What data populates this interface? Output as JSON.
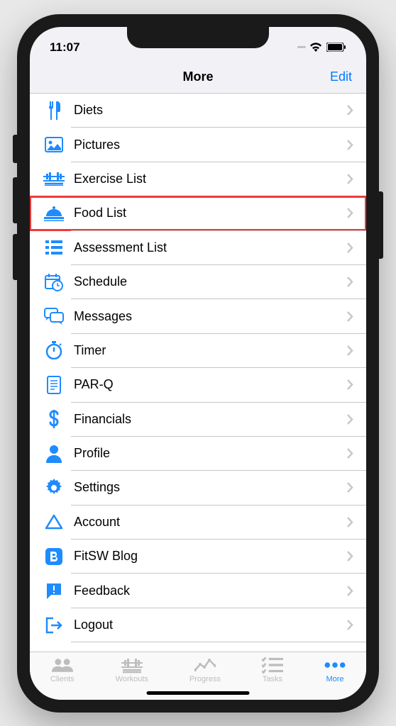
{
  "status": {
    "time": "11:07"
  },
  "nav": {
    "title": "More",
    "edit": "Edit"
  },
  "menu": {
    "items": [
      {
        "label": "Diets",
        "icon": "utensils-icon"
      },
      {
        "label": "Pictures",
        "icon": "image-icon"
      },
      {
        "label": "Exercise List",
        "icon": "barbell-icon"
      },
      {
        "label": "Food List",
        "icon": "cloche-icon",
        "highlighted": true
      },
      {
        "label": "Assessment List",
        "icon": "list-icon"
      },
      {
        "label": "Schedule",
        "icon": "calendar-clock-icon"
      },
      {
        "label": "Messages",
        "icon": "chat-icon"
      },
      {
        "label": "Timer",
        "icon": "stopwatch-icon"
      },
      {
        "label": "PAR-Q",
        "icon": "document-icon"
      },
      {
        "label": "Financials",
        "icon": "dollar-icon"
      },
      {
        "label": "Profile",
        "icon": "profile-icon"
      },
      {
        "label": "Settings",
        "icon": "gear-icon"
      },
      {
        "label": "Account",
        "icon": "triangle-icon"
      },
      {
        "label": "FitSW Blog",
        "icon": "blog-icon"
      },
      {
        "label": "Feedback",
        "icon": "feedback-icon"
      },
      {
        "label": "Logout",
        "icon": "logout-icon"
      }
    ]
  },
  "tabs": {
    "items": [
      {
        "label": "Clients",
        "icon": "people-icon"
      },
      {
        "label": "Workouts",
        "icon": "barbell-icon"
      },
      {
        "label": "Progress",
        "icon": "chart-icon"
      },
      {
        "label": "Tasks",
        "icon": "checklist-icon"
      },
      {
        "label": "More",
        "icon": "more-icon",
        "active": true
      }
    ]
  },
  "colors": {
    "accent": "#1e8bff",
    "highlight": "#ef3a3a"
  }
}
